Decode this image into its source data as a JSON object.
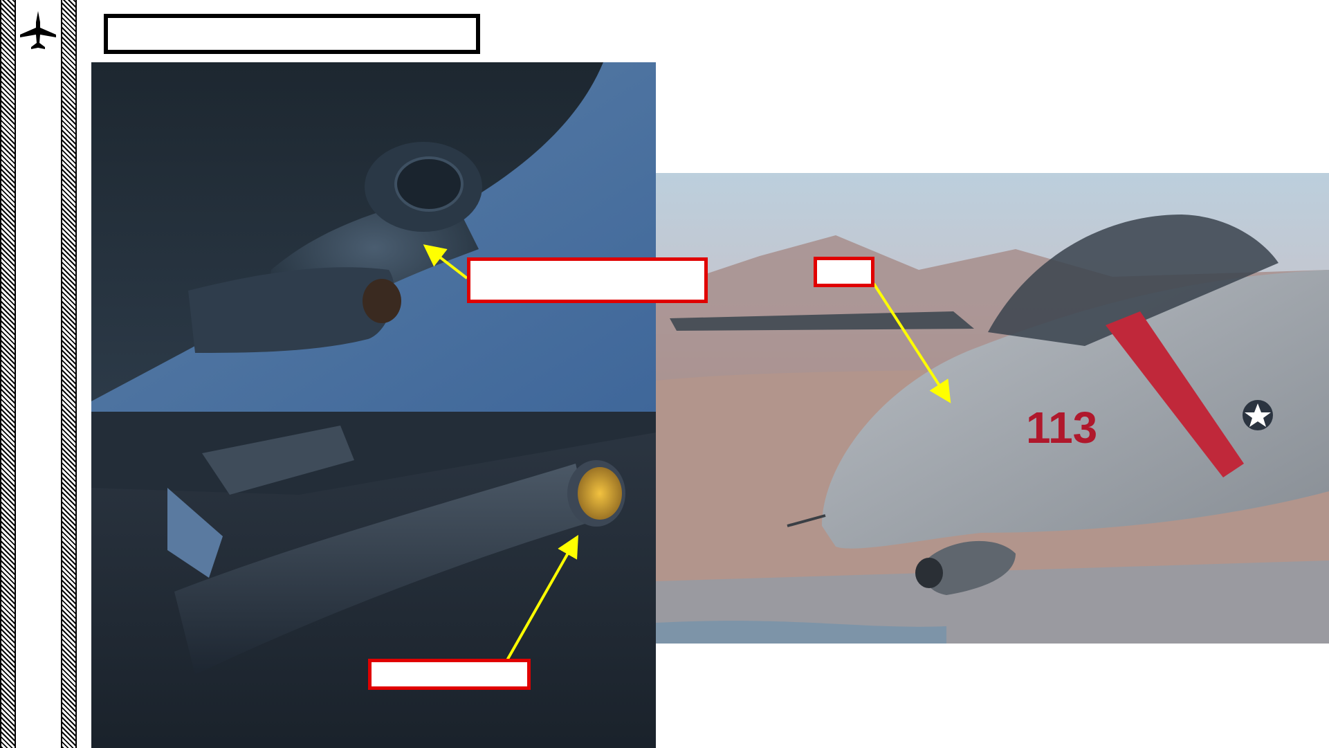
{
  "page": {
    "title": "",
    "icon": "jet-aircraft-icon"
  },
  "photos": {
    "top_left": {
      "subject": "underwing-pod-rear-view"
    },
    "bottom_left": {
      "subject": "missile-seeker-head"
    },
    "right": {
      "subject": "f14-tomcat-nose",
      "nose_number": "113"
    }
  },
  "callouts": {
    "pod_label": "",
    "seeker_label": "",
    "radome_label": ""
  },
  "colors": {
    "callout_border": "#e00000",
    "arrow": "#ffff00",
    "title_border": "#000000"
  }
}
